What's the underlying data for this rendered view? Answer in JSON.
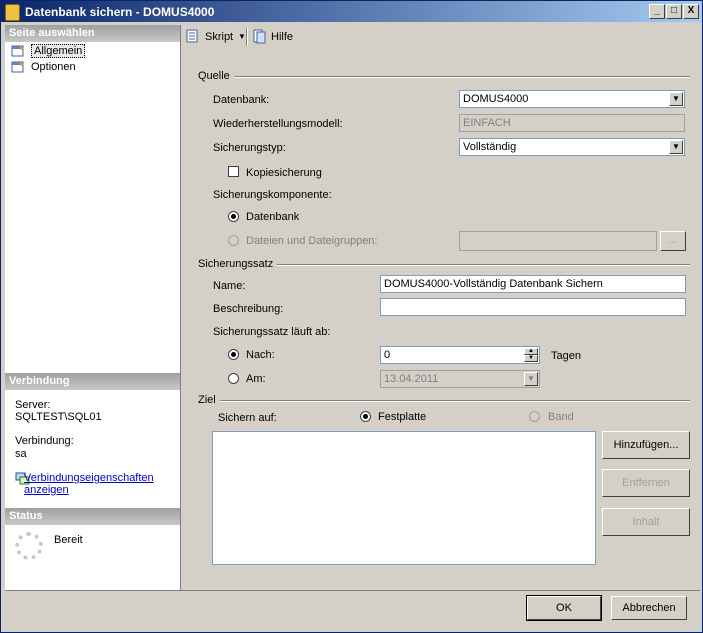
{
  "window": {
    "title": "Datenbank sichern - DOMUS4000",
    "min_label": "_",
    "max_label": "□",
    "close_label": "X"
  },
  "left": {
    "select_page_header": "Seite auswählen",
    "pages": [
      {
        "label": "Allgemein",
        "icon": "general-page-icon",
        "selected": true
      },
      {
        "label": "Optionen",
        "icon": "options-page-icon",
        "selected": false
      }
    ],
    "connection": {
      "header": "Verbindung",
      "server_label": "Server:",
      "server_value": "SQLTEST\\SQL01",
      "connection_label": "Verbindung:",
      "connection_value": "sa",
      "properties_link_line1": "Verbindungseigenschaften",
      "properties_link_line2": "anzeigen"
    },
    "status": {
      "header": "Status",
      "value": "Bereit"
    }
  },
  "toolbar": {
    "script_label": "Skript",
    "help_label": "Hilfe"
  },
  "source": {
    "group_label": "Quelle",
    "database_label": "Datenbank:",
    "database_value": "DOMUS4000",
    "recovery_model_label": "Wiederherstellungsmodell:",
    "recovery_model_value": "EINFACH",
    "backup_type_label": "Sicherungstyp:",
    "backup_type_value": "Vollständig",
    "copy_only_label": "Kopiesicherung",
    "copy_only_checked": false,
    "component_label": "Sicherungskomponente:",
    "component_database_label": "Datenbank",
    "component_files_label": "Dateien und Dateigruppen:",
    "files_browse_label": "..."
  },
  "backup_set": {
    "group_label": "Sicherungssatz",
    "name_label": "Name:",
    "name_value": "DOMUS4000-Vollständig Datenbank Sichern",
    "description_label": "Beschreibung:",
    "description_value": "",
    "expires_label": "Sicherungssatz läuft ab:",
    "after_label": "Nach:",
    "after_value": "0",
    "days_label": "Tagen",
    "on_label": "Am:",
    "on_value": "13.04.2011"
  },
  "destination": {
    "group_label": "Ziel",
    "backup_to_label": "Sichern auf:",
    "disk_label": "Festplatte",
    "tape_label": "Band",
    "add_button": "Hinzufügen...",
    "remove_button": "Entfernen",
    "contents_button": "Inhalt"
  },
  "footer": {
    "ok_button": "OK",
    "cancel_button": "Abbrechen"
  }
}
